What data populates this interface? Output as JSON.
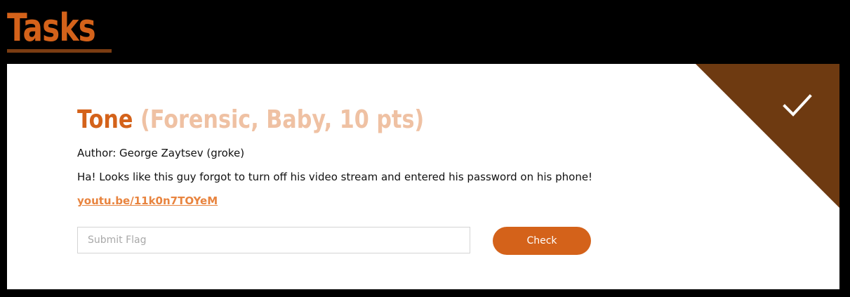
{
  "page": {
    "title": "Tasks"
  },
  "task": {
    "name": "Tone",
    "meta": " (Forensic, Baby, 10 pts)",
    "author": "Author: George Zaytsev (groke)",
    "description": "Ha! Looks like this guy forgot to turn off his video stream and entered his password on his phone!",
    "link_text": "youtu.be/11k0n7TOYeM",
    "solved": true,
    "solved_icon": "checkmark-icon"
  },
  "form": {
    "flag_placeholder": "Submit Flag",
    "flag_value": "",
    "check_label": "Check"
  },
  "colors": {
    "accent": "#d4621a",
    "accent_light": "#efc1a3",
    "link": "#e8843f",
    "solved_corner": "#6e3a11",
    "underline": "#7a3c12"
  }
}
